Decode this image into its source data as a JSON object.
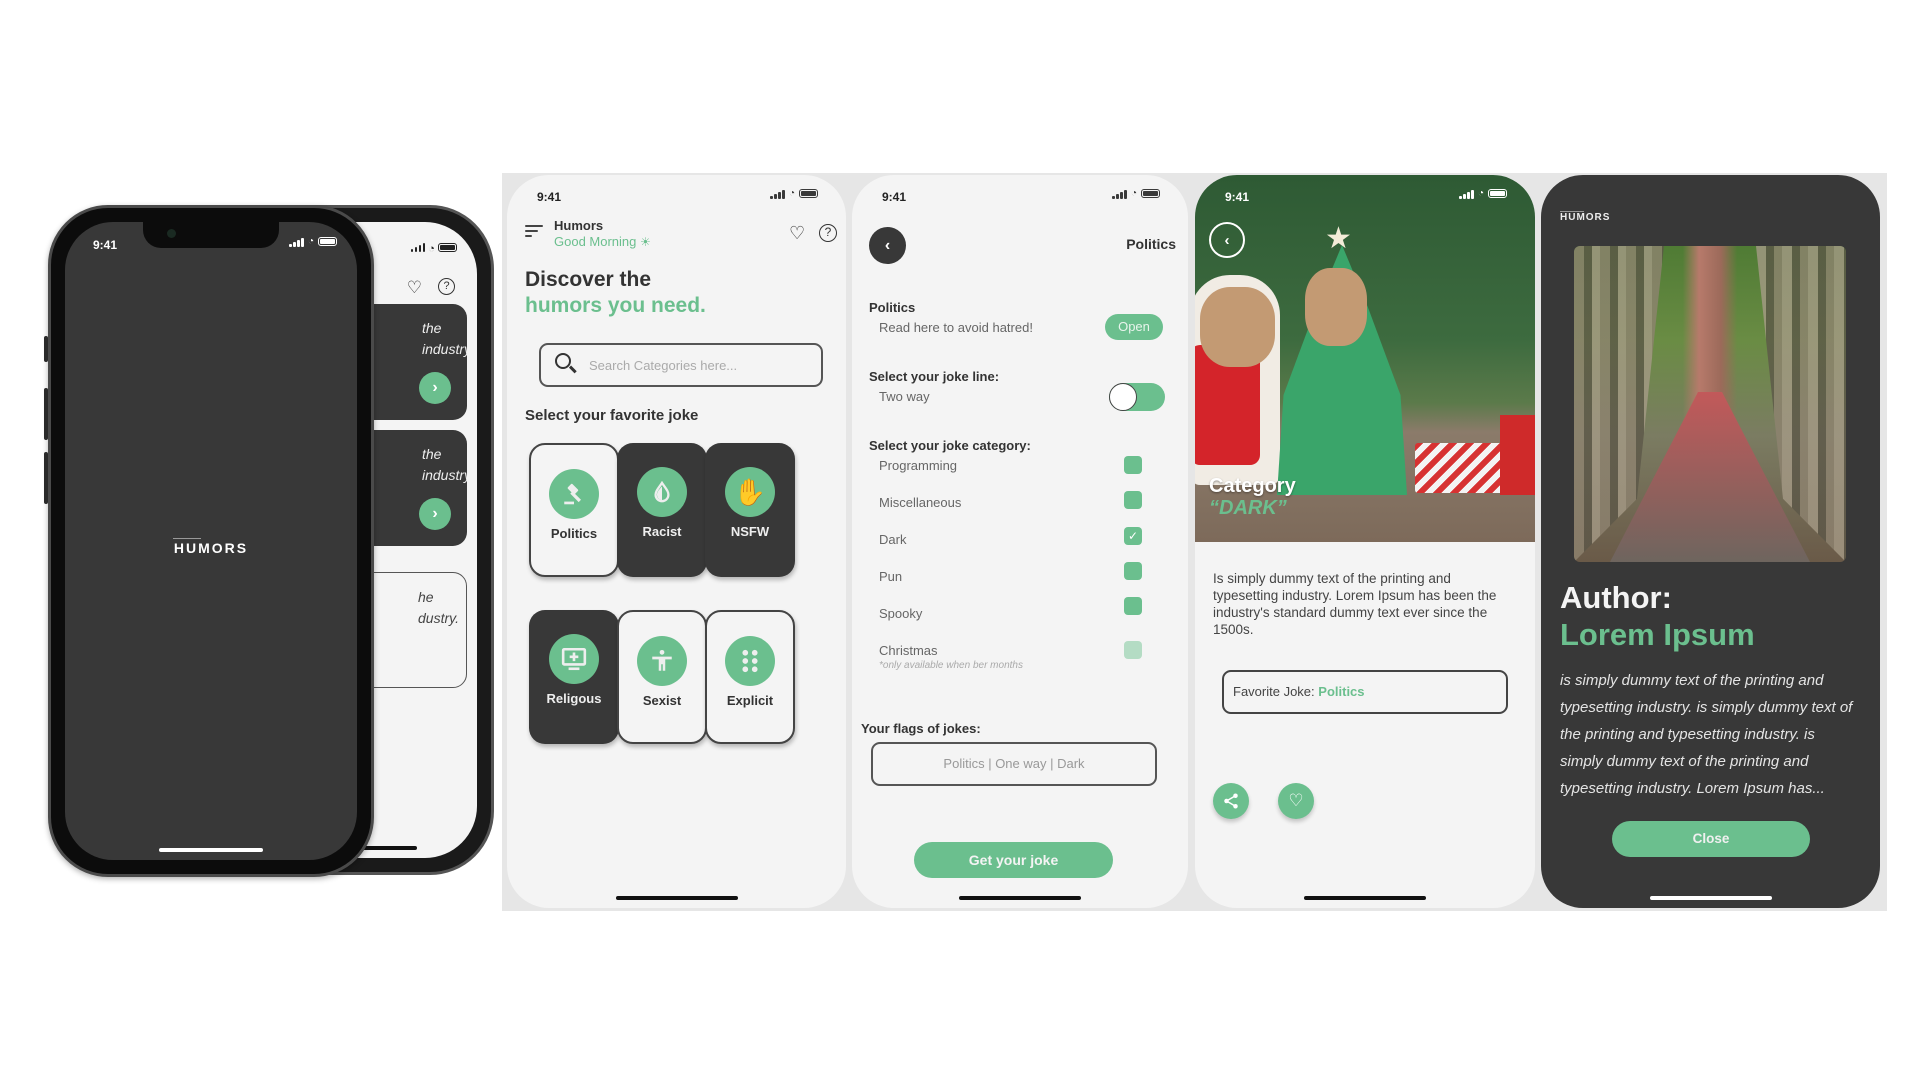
{
  "status_time": "9:41",
  "brand": {
    "logo_text": "HUMORS",
    "accent_color": "#6bbf8e",
    "dark_color": "#383838",
    "light_bg": "#f4f4f4"
  },
  "splash": {
    "logo": "HUMORS"
  },
  "back_phone": {
    "cards": [
      {
        "text_line1": "the",
        "text_line2": "industry.",
        "style": "dark",
        "action_icon": "chevron-right-icon"
      },
      {
        "text_line1": "the",
        "text_line2": "industry.",
        "style": "dark",
        "action_icon": "chevron-right-icon"
      },
      {
        "text_line1": "he",
        "text_line2": "dustry.",
        "style": "light"
      }
    ]
  },
  "home": {
    "app_name": "Humors",
    "greeting": "Good Morning",
    "greeting_icon": "sun-cloud-icon",
    "headline_line1": "Discover the",
    "headline_line2": "humors you need.",
    "search_placeholder": "Search Categories here...",
    "section_title": "Select your favorite joke",
    "categories": [
      {
        "label": "Politics",
        "icon": "gavel-icon",
        "style": "light"
      },
      {
        "label": "Racist",
        "icon": "drop-icon",
        "style": "dark"
      },
      {
        "label": "NSFW",
        "icon": "hand-stop-icon",
        "style": "dark"
      },
      {
        "label": "Religous",
        "icon": "monitor-plus-icon",
        "style": "dark"
      },
      {
        "label": "Sexist",
        "icon": "person-icon",
        "style": "light"
      },
      {
        "label": "Explicit",
        "icon": "dots-grid-icon",
        "style": "light"
      }
    ]
  },
  "settings": {
    "title": "Politics",
    "topic_heading": "Politics",
    "topic_sub": "Read here to avoid hatred!",
    "open_label": "Open",
    "joke_line_heading": "Select your joke line:",
    "joke_line_value": "Two way",
    "joke_line_toggle_on": false,
    "category_heading": "Select your joke category:",
    "categories": [
      {
        "label": "Programming",
        "checked": false,
        "disabled": false
      },
      {
        "label": "Miscellaneous",
        "checked": false,
        "disabled": false
      },
      {
        "label": "Dark",
        "checked": true,
        "disabled": false
      },
      {
        "label": "Pun",
        "checked": false,
        "disabled": false
      },
      {
        "label": "Spooky",
        "checked": false,
        "disabled": false
      },
      {
        "label": "Christmas",
        "checked": false,
        "disabled": true,
        "note": "*only available when ber months"
      }
    ],
    "flags_heading": "Your flags of jokes:",
    "flags_value": "Politics | One way | Dark",
    "cta_label": "Get your joke"
  },
  "joke": {
    "category_label": "Category",
    "category_value": "“DARK”",
    "body": "Is simply dummy text of the printing and typesetting industry. Lorem Ipsum has been the industry's standard dummy text ever since the 1500s.",
    "favorite_label": "Favorite Joke:",
    "favorite_value": "Politics"
  },
  "author": {
    "logo": "HUMORS",
    "heading": "Author:",
    "name": "Lorem Ipsum",
    "bio": "is simply dummy text of the printing and typesetting industry. is simply dummy text of the printing and typesetting industry. is simply dummy text of the printing and typesetting industry. Lorem Ipsum has...",
    "close_label": "Close"
  }
}
